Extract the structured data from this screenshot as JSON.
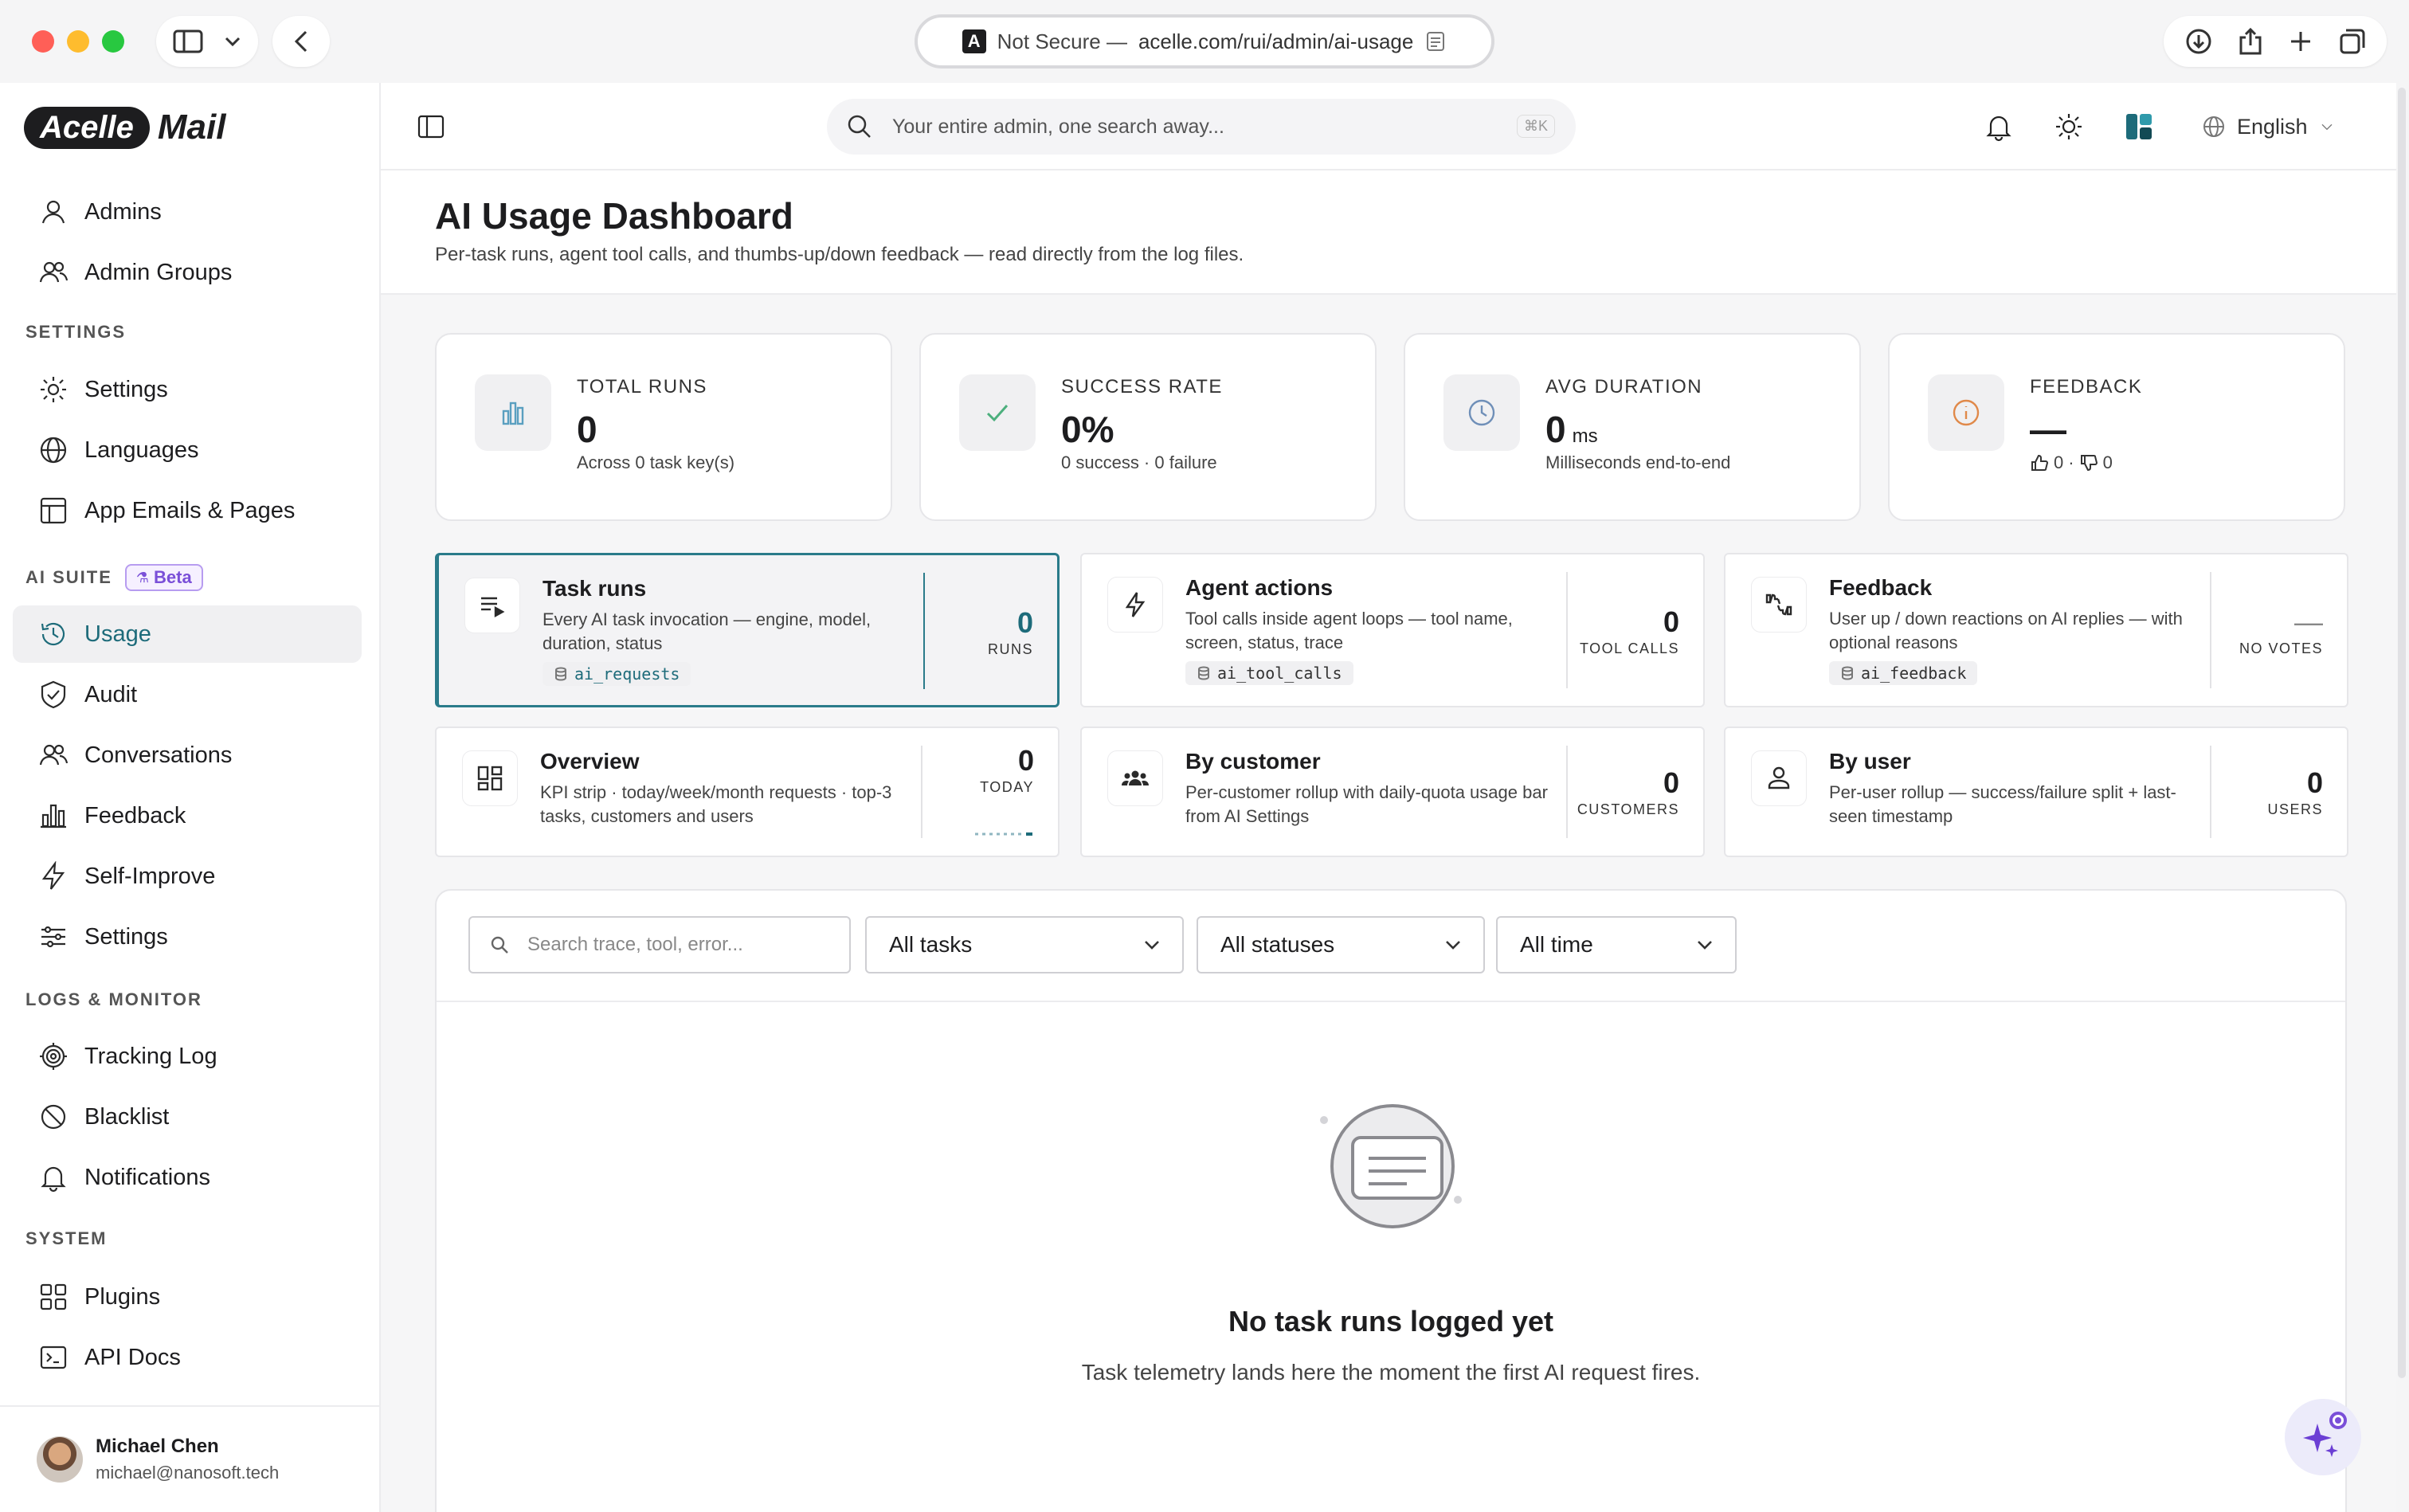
{
  "browser": {
    "url_prefix": "Not Secure —",
    "url_domain": "acelle.com/rui/admin/ai-usage"
  },
  "logo": {
    "part1": "Acelle",
    "part2": "Mail"
  },
  "sidebar": {
    "items_top": [
      {
        "label": "Admins"
      },
      {
        "label": "Admin Groups"
      }
    ],
    "section_settings": "SETTINGS",
    "items_settings": [
      {
        "label": "Settings"
      },
      {
        "label": "Languages"
      },
      {
        "label": "App Emails & Pages"
      }
    ],
    "section_ai": "AI SUITE",
    "beta_label": "Beta",
    "items_ai": [
      {
        "label": "Usage"
      },
      {
        "label": "Audit"
      },
      {
        "label": "Conversations"
      },
      {
        "label": "Feedback"
      },
      {
        "label": "Self-Improve"
      },
      {
        "label": "Settings"
      }
    ],
    "section_logs": "LOGS & MONITOR",
    "items_logs": [
      {
        "label": "Tracking Log"
      },
      {
        "label": "Blacklist"
      },
      {
        "label": "Notifications"
      }
    ],
    "section_system": "SYSTEM",
    "items_system": [
      {
        "label": "Plugins"
      },
      {
        "label": "API Docs"
      }
    ],
    "user": {
      "name": "Michael Chen",
      "email": "michael@nanosoft.tech"
    }
  },
  "topbar": {
    "search_placeholder": "Your entire admin, one search away...",
    "search_shortcut": "⌘K",
    "language": "English"
  },
  "page": {
    "title": "AI Usage Dashboard",
    "subtitle": "Per-task runs, agent tool calls, and thumbs-up/down feedback — read directly from the log files."
  },
  "kpis": [
    {
      "label": "TOTAL RUNS",
      "value": "0",
      "sub": "Across 0 task key(s)"
    },
    {
      "label": "SUCCESS RATE",
      "value": "0%",
      "sub": "0 success · 0 failure"
    },
    {
      "label": "AVG DURATION",
      "value": "0",
      "unit": "ms",
      "sub": "Milliseconds end-to-end"
    },
    {
      "label": "FEEDBACK",
      "value": "—",
      "up": "0",
      "sep": "·",
      "down": "0"
    }
  ],
  "tiles": [
    {
      "title": "Task runs",
      "desc": "Every AI task invocation — engine, model, duration, status",
      "tag": "ai_requests",
      "value": "0",
      "unit": "RUNS"
    },
    {
      "title": "Agent actions",
      "desc": "Tool calls inside agent loops — tool name, screen, status, trace",
      "tag": "ai_tool_calls",
      "value": "0",
      "unit": "TOOL CALLS"
    },
    {
      "title": "Feedback",
      "desc": "User up / down reactions on AI replies — with optional reasons",
      "tag": "ai_feedback",
      "value": "—",
      "unit": "NO VOTES"
    },
    {
      "title": "Overview",
      "desc": "KPI strip · today/week/month requests · top-3 tasks, customers and users",
      "value": "0",
      "unit": "TODAY"
    },
    {
      "title": "By customer",
      "desc": "Per-customer rollup with daily-quota usage bar from AI Settings",
      "value": "0",
      "unit": "CUSTOMERS"
    },
    {
      "title": "By user",
      "desc": "Per-user rollup — success/failure split + last-seen timestamp",
      "value": "0",
      "unit": "USERS"
    }
  ],
  "filters": {
    "search_placeholder": "Search trace, tool, error...",
    "tasks": "All tasks",
    "statuses": "All statuses",
    "time": "All time"
  },
  "empty": {
    "title": "No task runs logged yet",
    "text": "Task telemetry lands here the moment the first AI request fires."
  },
  "colors": {
    "accent": "#1d6b7a",
    "beta": "#7a4fd8",
    "success": "#4caf7d",
    "warning": "#e0894a"
  }
}
